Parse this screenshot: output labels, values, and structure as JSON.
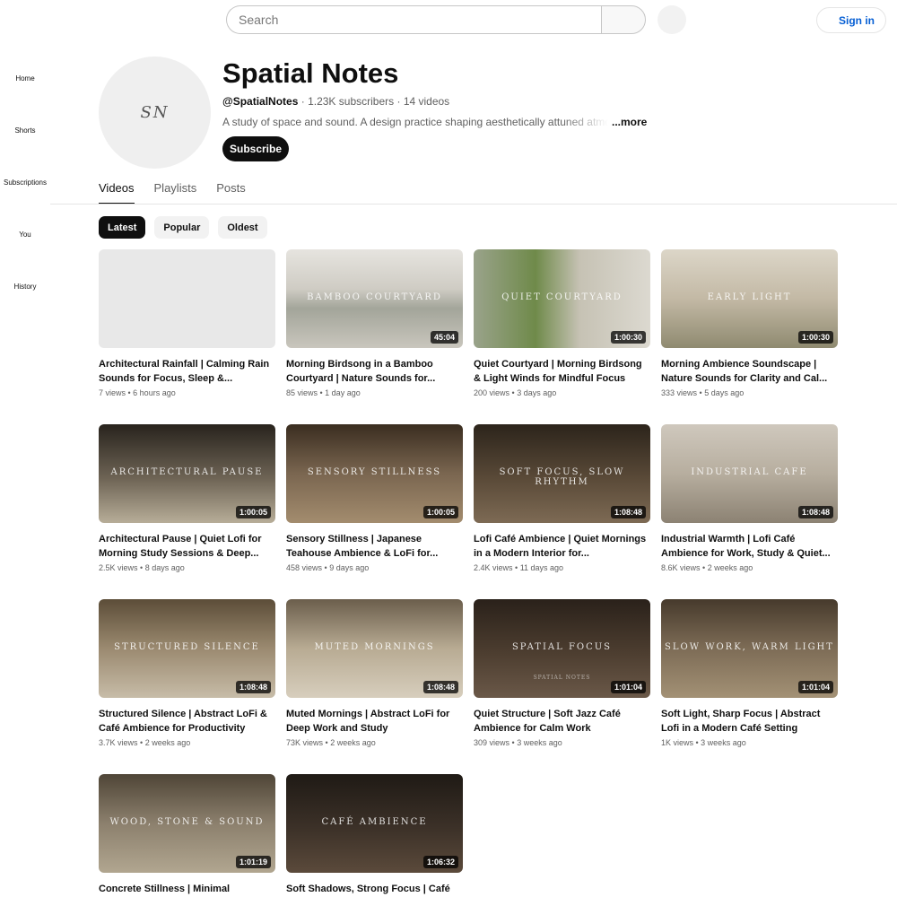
{
  "topbar": {
    "search_placeholder": "Search",
    "signin_label": "Sign in"
  },
  "sidebar": {
    "items": [
      {
        "label": "Home"
      },
      {
        "label": "Shorts"
      },
      {
        "label": "Subscriptions"
      },
      {
        "label": "You"
      },
      {
        "label": "History"
      }
    ]
  },
  "channel": {
    "avatar_logo": "SN",
    "name": "Spatial Notes",
    "handle": "@SpatialNotes",
    "subscribers": "1.23K subscribers",
    "video_count": "14 videos",
    "separator": "·",
    "description": "A study of space and sound. A design practice shaping aesthetically attuned atmospheres",
    "more_label": "...more",
    "subscribe_label": "Subscribe"
  },
  "tabs": [
    {
      "label": "Videos",
      "active": true
    },
    {
      "label": "Playlists",
      "active": false
    },
    {
      "label": "Posts",
      "active": false
    }
  ],
  "chips": [
    {
      "label": "Latest",
      "active": true
    },
    {
      "label": "Popular",
      "active": false
    },
    {
      "label": "Oldest",
      "active": false
    }
  ],
  "videos": [
    {
      "thumb_text": "",
      "duration": "",
      "title": "Architectural Rainfall | Calming Rain Sounds for Focus, Sleep &...",
      "views": "7 views",
      "age": "6 hours ago"
    },
    {
      "thumb_text": "BAMBOO COURTYARD",
      "duration": "45:04",
      "title": "Morning Birdsong in a Bamboo Courtyard | Nature Sounds for...",
      "views": "85 views",
      "age": "1 day ago"
    },
    {
      "thumb_text": "QUIET COURTYARD",
      "duration": "1:00:30",
      "title": "Quiet Courtyard | Morning Birdsong & Light Winds for Mindful Focus",
      "views": "200 views",
      "age": "3 days ago"
    },
    {
      "thumb_text": "EARLY LIGHT",
      "duration": "1:00:30",
      "title": "Morning Ambience Soundscape | Nature Sounds for Clarity and Cal...",
      "views": "333 views",
      "age": "5 days ago"
    },
    {
      "thumb_text": "ARCHITECTURAL PAUSE",
      "duration": "1:00:05",
      "title": "Architectural Pause | Quiet Lofi for Morning Study Sessions & Deep...",
      "views": "2.5K views",
      "age": "8 days ago"
    },
    {
      "thumb_text": "SENSORY STILLNESS",
      "duration": "1:00:05",
      "title": "Sensory Stillness | Japanese Teahouse Ambience & LoFi for...",
      "views": "458 views",
      "age": "9 days ago"
    },
    {
      "thumb_text": "SOFT FOCUS, SLOW RHYTHM",
      "duration": "1:08:48",
      "title": "Lofi Café Ambience | Quiet Mornings in a Modern Interior for...",
      "views": "2.4K views",
      "age": "11 days ago"
    },
    {
      "thumb_text": "INDUSTRIAL CAFE",
      "duration": "1:08:48",
      "title": "Industrial Warmth | Lofi Café Ambience for Work, Study & Quiet...",
      "views": "8.6K views",
      "age": "2 weeks ago"
    },
    {
      "thumb_text": "STRUCTURED SILENCE",
      "duration": "1:08:48",
      "title": "Structured Silence | Abstract LoFi & Café Ambience for Productivity",
      "views": "3.7K views",
      "age": "2 weeks ago"
    },
    {
      "thumb_text": "MUTED MORNINGS",
      "duration": "1:08:48",
      "title": "Muted Mornings | Abstract LoFi for Deep Work and Study",
      "views": "73K views",
      "age": "2 weeks ago"
    },
    {
      "thumb_text": "SPATIAL FOCUS",
      "thumb_sub": "SPATIAL NOTES",
      "duration": "1:01:04",
      "title": "Quiet Structure | Soft Jazz Café Ambience for Calm Work",
      "views": "309 views",
      "age": "3 weeks ago"
    },
    {
      "thumb_text": "SLOW WORK, WARM LIGHT",
      "duration": "1:01:04",
      "title": "Soft Light, Sharp Focus | Abstract Lofi in a Modern Café Setting",
      "views": "1K views",
      "age": "3 weeks ago"
    },
    {
      "thumb_text": "WOOD, STONE & SOUND",
      "duration": "1:01:19",
      "title": "Concrete Stillness | Minimal",
      "views": "",
      "age": ""
    },
    {
      "thumb_text": "CAFÉ AMBIENCE",
      "duration": "1:06:32",
      "title": "Soft Shadows, Strong Focus | Café",
      "views": "",
      "age": ""
    }
  ]
}
